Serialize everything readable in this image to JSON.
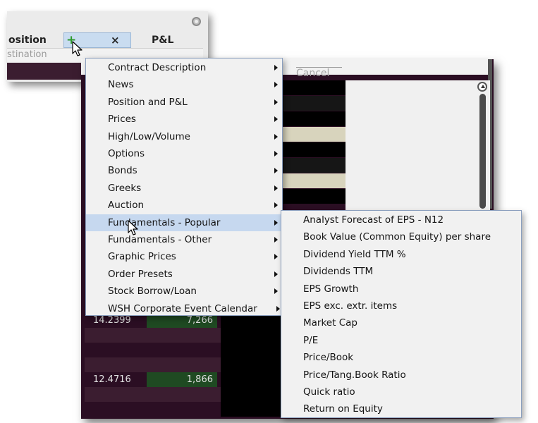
{
  "header": {
    "position_label": "osition",
    "pl_label": "P&L",
    "destination_label": "stination",
    "add_icon": "+",
    "close_icon": "×"
  },
  "grid": {
    "cancel_label": "Cancel",
    "rows": [
      {
        "price": "14.2399",
        "size": "7,266"
      },
      {
        "price": "12.4716",
        "size": "1,866"
      }
    ]
  },
  "context_menu": {
    "items": [
      {
        "label": "Contract Description",
        "submenu": true
      },
      {
        "label": "News",
        "submenu": true
      },
      {
        "label": "Position and P&L",
        "submenu": true
      },
      {
        "label": "Prices",
        "submenu": true
      },
      {
        "label": "High/Low/Volume",
        "submenu": true
      },
      {
        "label": "Options",
        "submenu": true
      },
      {
        "label": "Bonds",
        "submenu": true
      },
      {
        "label": "Greeks",
        "submenu": true
      },
      {
        "label": "Auction",
        "submenu": true
      },
      {
        "label": "Fundamentals - Popular",
        "submenu": true,
        "highlighted": true
      },
      {
        "label": "Fundamentals - Other",
        "submenu": true
      },
      {
        "label": "Graphic Prices",
        "submenu": true
      },
      {
        "label": "Order Presets",
        "submenu": true
      },
      {
        "label": "Stock Borrow/Loan",
        "submenu": true
      },
      {
        "label": "WSH Corporate Event Calendar",
        "submenu": true
      }
    ]
  },
  "submenu": {
    "items": [
      "Analyst Forecast of EPS - N12",
      "Book Value (Common Equity) per share",
      "Dividend Yield TTM %",
      "Dividends TTM",
      "EPS Growth",
      "EPS exc. extr. items",
      "Market Cap",
      "P/E",
      "Price/Book",
      "Price/Tang.Book Ratio",
      "Quick ratio",
      "Return on Equity"
    ]
  },
  "colors": {
    "menu_bg": "#f1f1f1",
    "menu_highlight": "#c6d8ef",
    "menu_border": "#8b9fbe",
    "grid_dark": "#2b0e23",
    "grid_stripe": "#3b1d30",
    "cell_green": "#1f4a22",
    "cream_stripe": "#d8d4bd"
  }
}
